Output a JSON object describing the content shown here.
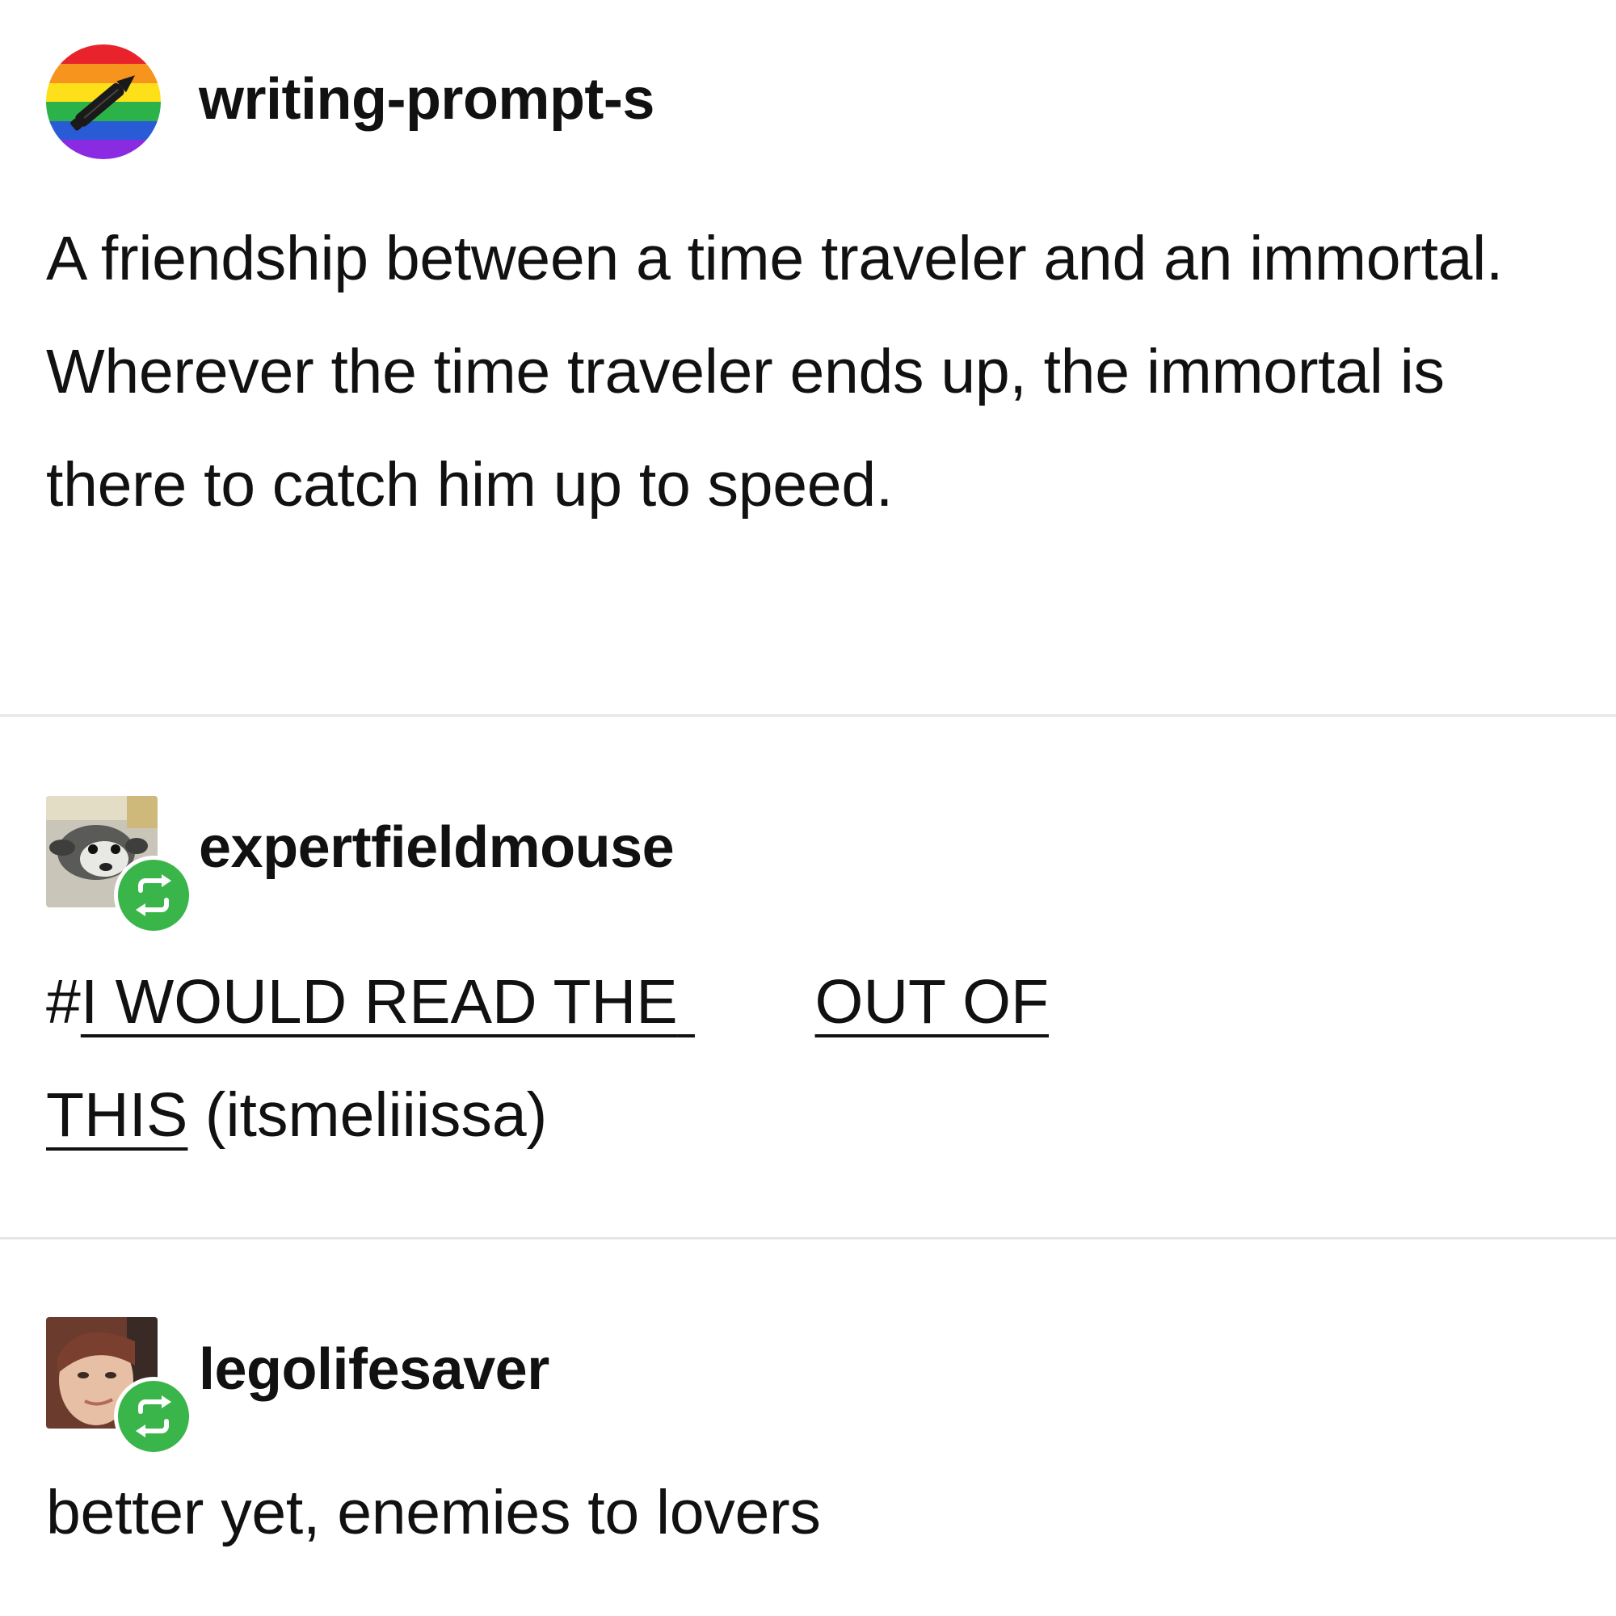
{
  "posts": [
    {
      "username": "writing-prompt-s",
      "avatar_icon": "rainbow-pen-avatar-icon",
      "text": "A friendship between a time traveler and an immortal. Wherever the time traveler ends up, the immortal is there to catch him up to speed."
    },
    {
      "username": "expertfieldmouse",
      "avatar_icon": "dog-photo-avatar",
      "badge_icon": "reblog-icon",
      "tag_prefix": "#",
      "tag_part1": "I WOULD READ THE",
      "tag_part2": "OUT OF",
      "tag_part3": "THIS",
      "tag_suffix": " (itsmeliiissa)"
    },
    {
      "username": "legolifesaver",
      "avatar_icon": "person-photo-avatar",
      "badge_icon": "reblog-icon",
      "text": "better yet, enemies to lovers"
    }
  ],
  "colors": {
    "reblog_green": "#3ab54a",
    "divider": "#e6e6e6",
    "text": "#111111"
  }
}
